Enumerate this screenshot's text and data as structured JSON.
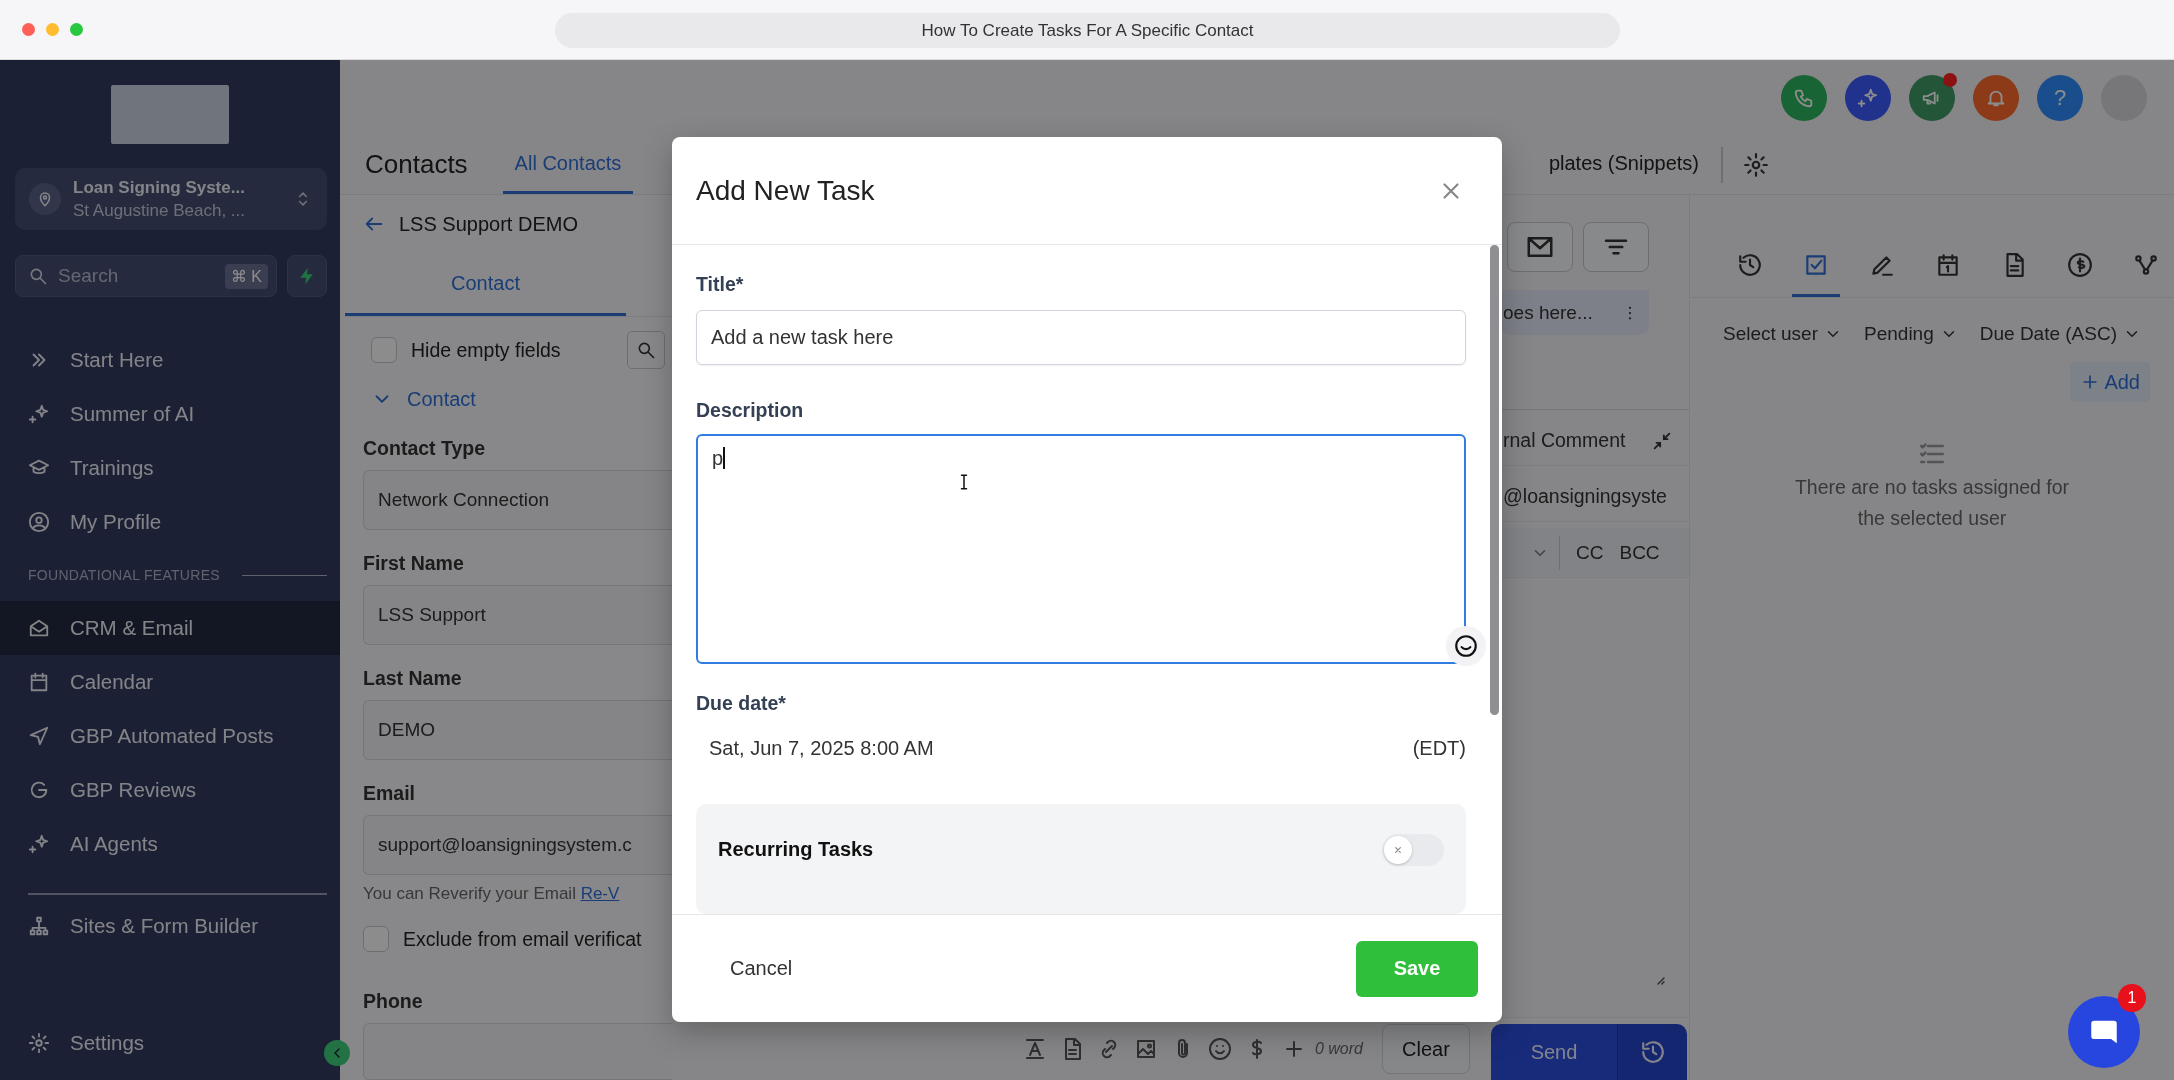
{
  "browser": {
    "title": "How To Create Tasks For A Specific Contact"
  },
  "sidebar": {
    "account": {
      "name": "Loan Signing Syste...",
      "location": "St Augustine Beach, ..."
    },
    "search": {
      "placeholder": "Search",
      "shortcut": "⌘ K"
    },
    "items": [
      {
        "label": "Start Here",
        "selected": false
      },
      {
        "label": "Summer of AI",
        "selected": false
      },
      {
        "label": "Trainings",
        "selected": false
      },
      {
        "label": "My Profile",
        "selected": false
      }
    ],
    "section_label": "FOUNDATIONAL FEATURES",
    "section_items": [
      {
        "label": "CRM & Email",
        "selected": true
      },
      {
        "label": "Calendar",
        "selected": false
      },
      {
        "label": "GBP Automated Posts",
        "selected": false
      },
      {
        "label": "GBP Reviews",
        "selected": false
      },
      {
        "label": "AI Agents",
        "selected": false
      }
    ],
    "bottom_items": [
      {
        "label": "Sites & Form Builder",
        "selected": false
      }
    ],
    "settings": "Settings"
  },
  "top_bar": {
    "megaphone_unread": true,
    "help_label": "?"
  },
  "header": {
    "title": "Contacts",
    "tabs": [
      {
        "label": "All Contacts",
        "selected": true
      }
    ],
    "right_tab": {
      "label": "plates (Snippets)",
      "selected": false
    }
  },
  "contact": {
    "name": "LSS Support DEMO",
    "tabs": [
      {
        "label": "Contact",
        "selected": true
      }
    ],
    "hide_empty": {
      "label": "Hide empty fields",
      "checked": false
    },
    "section": {
      "label": "Contact",
      "expanded": true
    },
    "fields": [
      {
        "label": "Contact Type",
        "value": "Network Connection"
      },
      {
        "label": "First Name",
        "value": "LSS Support"
      },
      {
        "label": "Last Name",
        "value": "DEMO"
      },
      {
        "label": "Email",
        "value": "support@loansigningsystem.c"
      }
    ],
    "email_hint": "You can Reverify your Email",
    "reverify_link": "Re-V",
    "exclude": {
      "label": "Exclude from email verificat",
      "checked": false
    },
    "phone_label": "Phone"
  },
  "conversation": {
    "message_preview": "oes here...",
    "comment_tab": "rnal Comment",
    "from": "@loansigningsyste",
    "cc": "CC",
    "bcc": "BCC",
    "word_count": "0 word",
    "clear": "Clear",
    "send": "Send"
  },
  "tasks_panel": {
    "tabs": [
      {
        "selected": false
      },
      {
        "selected": true
      },
      {
        "selected": false
      },
      {
        "selected": false
      },
      {
        "selected": false
      },
      {
        "selected": false
      },
      {
        "selected": false
      }
    ],
    "filters": [
      "Select user",
      "Pending",
      "Due Date (ASC)"
    ],
    "add": "Add",
    "empty": "There are no tasks assigned for the selected user"
  },
  "modal": {
    "title": "Add New Task",
    "title_label": "Title*",
    "title_value": "Add a new task here",
    "description_label": "Description",
    "description_value": "p",
    "due_label": "Due date*",
    "due_value": "Sat, Jun 7, 2025 8:00 AM",
    "timezone": "(EDT)",
    "recurring": {
      "label": "Recurring Tasks",
      "on": false
    },
    "cancel": "Cancel",
    "save": "Save"
  },
  "chat": {
    "badge": "1"
  }
}
